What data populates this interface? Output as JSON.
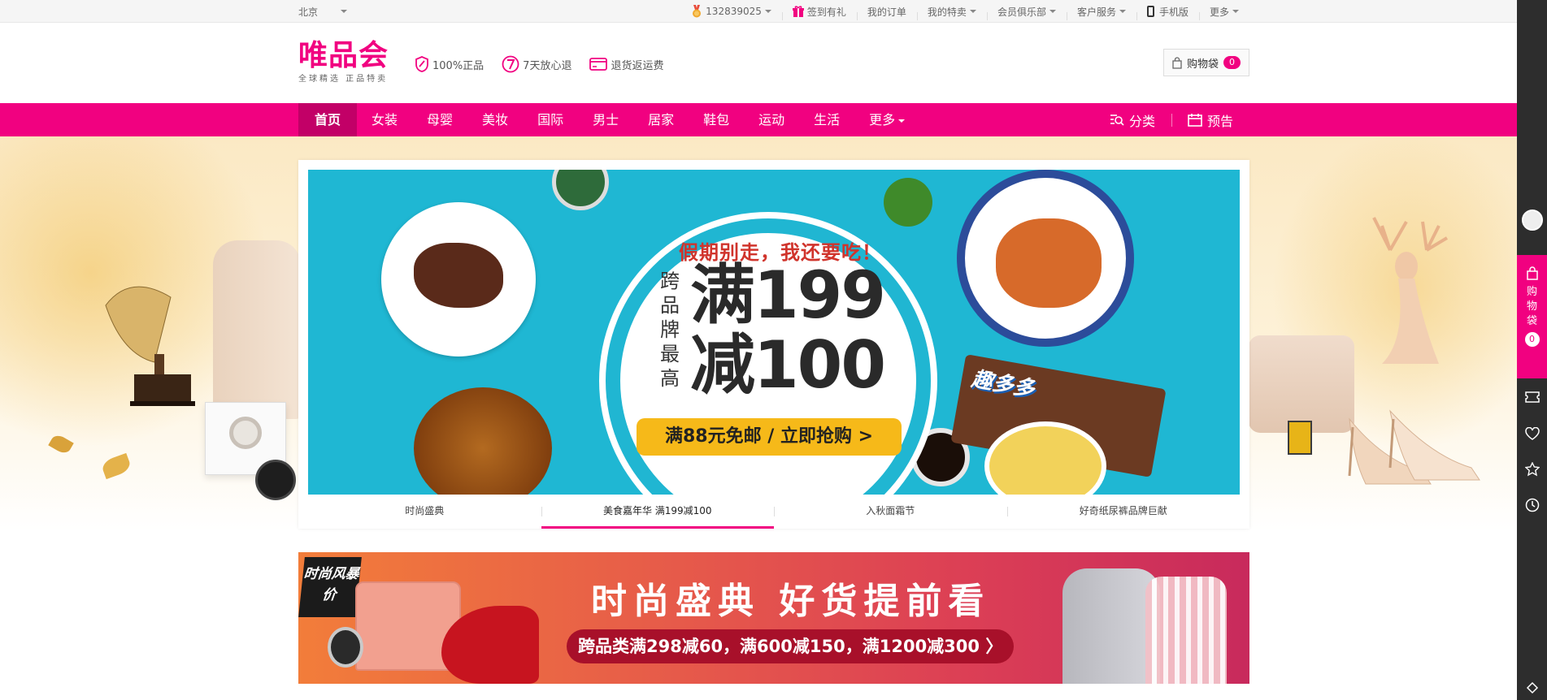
{
  "topbar": {
    "city": "北京",
    "links": [
      {
        "label": "132839025",
        "icon": "medal-icon",
        "dropdown": true
      },
      {
        "label": "签到有礼",
        "icon": "gift-icon",
        "dropdown": false
      },
      {
        "label": "我的订单",
        "dropdown": false
      },
      {
        "label": "我的特卖",
        "dropdown": true
      },
      {
        "label": "会员俱乐部",
        "dropdown": true
      },
      {
        "label": "客户服务",
        "dropdown": true
      },
      {
        "label": "手机版",
        "icon": "phone-icon",
        "dropdown": false
      },
      {
        "label": "更多",
        "dropdown": true
      }
    ]
  },
  "header": {
    "logo_main": "唯品会",
    "logo_sub": "全球精选  正品特卖",
    "badges": [
      {
        "label": "100%正品",
        "icon": "shield-icon"
      },
      {
        "label": "7天放心退",
        "icon": "seven-days-icon"
      },
      {
        "label": "退货返运费",
        "icon": "card-icon"
      }
    ],
    "cart_label": "购物袋",
    "cart_count": "0"
  },
  "nav": {
    "items": [
      "首页",
      "女装",
      "母婴",
      "美妆",
      "国际",
      "男士",
      "居家",
      "鞋包",
      "运动",
      "生活",
      "更多"
    ],
    "right": [
      {
        "label": "分类",
        "icon": "category-search-icon"
      },
      {
        "label": "预告",
        "icon": "calendar-icon"
      }
    ]
  },
  "carousel": {
    "banner": {
      "headline": "假期别走，我还要吃！",
      "vertical": "跨品牌最高",
      "line1": "满199",
      "line2": "减100",
      "cta": "满88元免邮 / 立即抢购 >",
      "snack_brand": "趣多多"
    },
    "tabs": [
      "时尚盛典",
      "美食嘉年华 满199减100",
      "入秋面霜节",
      "好奇纸尿裤品牌巨献"
    ],
    "active_tab": 1
  },
  "banner2": {
    "tag": "时尚风暴价",
    "title": "时尚盛典  好货提前看",
    "promo": "跨品类满298减60，满600减150，满1200减300 〉"
  },
  "sidebar": {
    "cart_label": "购物袋",
    "cart_count": "0",
    "icons": [
      "ticket-icon",
      "heart-icon",
      "star-icon",
      "history-icon",
      "collapse-icon"
    ]
  },
  "colors": {
    "brand": "#f10180",
    "nav_active": "#c20067",
    "banner_bg": "#1fb7d3",
    "cta": "#f6b919"
  }
}
